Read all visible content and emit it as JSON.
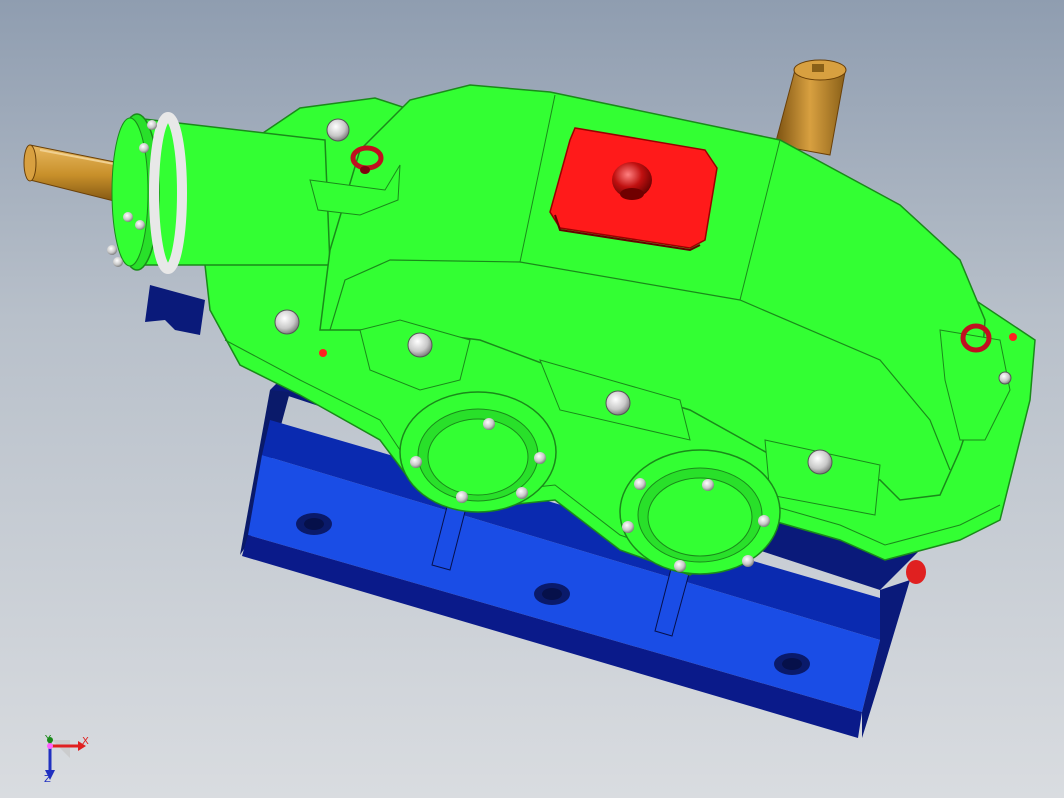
{
  "viewport": {
    "background_top": "#8f9db0",
    "background_bottom": "#d9dce0"
  },
  "model": {
    "housing_color": "#33ff33",
    "housing_edge_color": "#1a8a1a",
    "base_color": "#1a4de6",
    "base_dark_color": "#0a1a7a",
    "inspection_cover_color": "#ff1a1a",
    "shaft_color": "#c8902a",
    "bolt_color": "#d8d8d8",
    "lifting_eye_color": "#c01020"
  },
  "triad": {
    "x_label": "X",
    "y_label": "Y",
    "z_label": "Z",
    "x_color": "#e02020",
    "y_color": "#1a8a1a",
    "z_color": "#2030c0"
  }
}
